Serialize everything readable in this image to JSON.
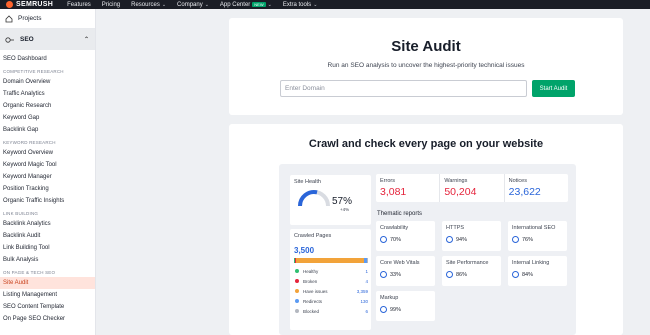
{
  "topbar": {
    "logo": "SEMRUSH",
    "nav": [
      {
        "label": "Features",
        "dropdown": false
      },
      {
        "label": "Pricing",
        "dropdown": false
      },
      {
        "label": "Resources",
        "dropdown": true
      },
      {
        "label": "Company",
        "dropdown": true
      },
      {
        "label": "App Center",
        "dropdown": true,
        "badge": "NEW"
      },
      {
        "label": "Extra tools",
        "dropdown": true
      }
    ]
  },
  "sidebar": {
    "projects": "Projects",
    "seo": "SEO",
    "items": {
      "seo_dashboard": "SEO Dashboard",
      "section_competitive": "COMPETITIVE RESEARCH",
      "domain_overview": "Domain Overview",
      "traffic_analytics": "Traffic Analytics",
      "organic_research": "Organic Research",
      "keyword_gap": "Keyword Gap",
      "backlink_gap": "Backlink Gap",
      "section_keyword": "KEYWORD RESEARCH",
      "keyword_overview": "Keyword Overview",
      "keyword_magic_tool": "Keyword Magic Tool",
      "keyword_manager": "Keyword Manager",
      "position_tracking": "Position Tracking",
      "organic_traffic_insights": "Organic Traffic Insights",
      "section_link": "LINK BUILDING",
      "backlink_analytics": "Backlink Analytics",
      "backlink_audit": "Backlink Audit",
      "link_building_tool": "Link Building Tool",
      "bulk_analysis": "Bulk Analysis",
      "section_onpage": "ON PAGE & TECH SEO",
      "site_audit": "Site Audit",
      "listing_management": "Listing Management",
      "seo_content_template": "SEO Content Template",
      "on_page_seo_checker": "On Page SEO Checker"
    }
  },
  "hero": {
    "title": "Site Audit",
    "subtitle": "Run an SEO analysis to uncover the highest-priority technical issues",
    "input_placeholder": "Enter Domain",
    "button": "Start Audit"
  },
  "crawl": {
    "title": "Crawl and check every page on your website",
    "site_health": {
      "label": "Site Health",
      "value": "57%",
      "delta": "+4%",
      "fraction": 0.57
    },
    "metrics": [
      {
        "label": "Errors",
        "value": "3,081",
        "color": "#e5243c"
      },
      {
        "label": "Warnings",
        "value": "50,204",
        "color": "#e5243c"
      },
      {
        "label": "Notices",
        "value": "23,622",
        "color": "#2a65d9"
      }
    ],
    "thematic_title": "Thematic reports",
    "thematic": [
      {
        "label": "Crawlability",
        "value": "70%"
      },
      {
        "label": "HTTPS",
        "value": "94%"
      },
      {
        "label": "International SEO",
        "value": "76%"
      },
      {
        "label": "Core Web Vitals",
        "value": "33%"
      },
      {
        "label": "Site Performance",
        "value": "86%"
      },
      {
        "label": "Internal Linking",
        "value": "84%"
      },
      {
        "label": "Markup",
        "value": "99%"
      }
    ],
    "crawled_pages": {
      "label": "Crawled Pages",
      "total": "3,500",
      "legend": [
        {
          "label": "Healthy",
          "value": "1",
          "color": "#2fbf71"
        },
        {
          "label": "Broken",
          "value": "4",
          "color": "#e5243c"
        },
        {
          "label": "Have issues",
          "value": "3,359",
          "color": "#f2a33a"
        },
        {
          "label": "Redirects",
          "value": "130",
          "color": "#5b9bf3"
        },
        {
          "label": "Blocked",
          "value": "6",
          "color": "#b4b8c0"
        }
      ]
    }
  }
}
